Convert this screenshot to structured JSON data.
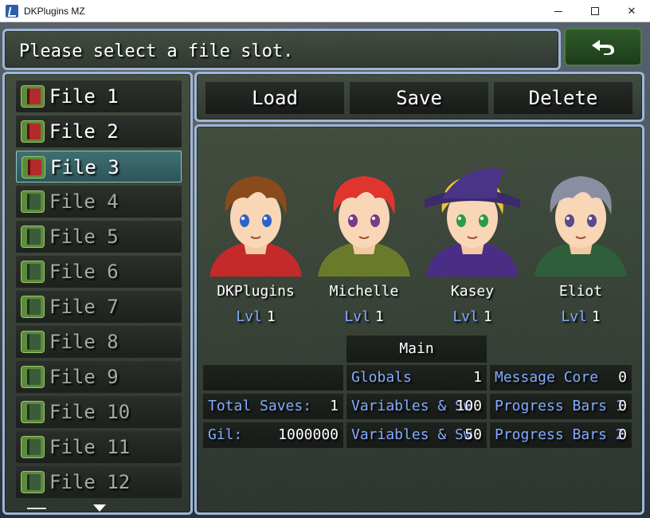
{
  "window": {
    "title": "DKPlugins MZ",
    "controls": [
      "minimize",
      "maximize",
      "close"
    ]
  },
  "help": {
    "text": "Please select a file slot."
  },
  "back_button": {
    "icon": "back-arrow-icon"
  },
  "file_list": {
    "items": [
      {
        "label": "File 1",
        "has_save": true
      },
      {
        "label": "File 2",
        "has_save": true
      },
      {
        "label": "File 3",
        "has_save": true,
        "selected": true
      },
      {
        "label": "File 4",
        "has_save": false
      },
      {
        "label": "File 5",
        "has_save": false
      },
      {
        "label": "File 6",
        "has_save": false
      },
      {
        "label": "File 7",
        "has_save": false
      },
      {
        "label": "File 8",
        "has_save": false
      },
      {
        "label": "File 9",
        "has_save": false
      },
      {
        "label": "File 10",
        "has_save": false
      },
      {
        "label": "File 11",
        "has_save": false
      },
      {
        "label": "File 12",
        "has_save": false
      }
    ]
  },
  "commands": {
    "load": "Load",
    "save": "Save",
    "delete": "Delete"
  },
  "party": [
    {
      "name": "DKPlugins",
      "lvl_label": "Lvl",
      "level": "1",
      "hair": "#8a4a1c",
      "eyes": "#2d63c8",
      "outfit": "#c42a2a"
    },
    {
      "name": "Michelle",
      "lvl_label": "Lvl",
      "level": "1",
      "hair": "#e0352e",
      "eyes": "#7a3a8a",
      "outfit": "#6a7a2a"
    },
    {
      "name": "Kasey",
      "lvl_label": "Lvl",
      "level": "1",
      "hair": "#f0c23a",
      "eyes": "#2c9a4a",
      "outfit": "#4a2e86"
    },
    {
      "name": "Eliot",
      "lvl_label": "Lvl",
      "level": "1",
      "hair": "#8a8ea2",
      "eyes": "#5a4a8a",
      "outfit": "#2f5f3a"
    }
  ],
  "stats": {
    "main_header": "Main",
    "left": [
      {
        "key": "",
        "value": ""
      },
      {
        "key": "Total Saves:",
        "value": "1"
      },
      {
        "key": "Gil:",
        "value": "1000000"
      }
    ],
    "middle": [
      {
        "key": "Globals",
        "value": "1"
      },
      {
        "key": "Variables & Sw",
        "value": "100"
      },
      {
        "key": "Variables & Sw",
        "value": "50"
      }
    ],
    "right": [
      {
        "key": "Message Core",
        "value": "0"
      },
      {
        "key": "Progress Bars 1",
        "value": "0"
      },
      {
        "key": "Progress Bars 2",
        "value": "0"
      }
    ]
  },
  "colors": {
    "window_border": "#9fb6d8",
    "selected_row": "#3f6f73",
    "system_text": "#84aaff",
    "back_button": "#2f5a2a"
  }
}
